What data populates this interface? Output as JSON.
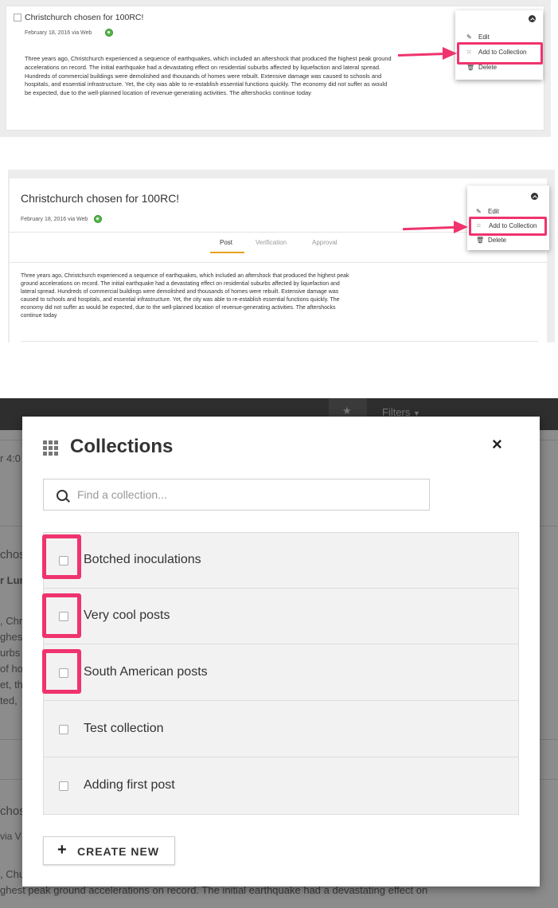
{
  "panel1": {
    "title": "Christchurch chosen for 100RC!",
    "meta": "February 18, 2016 via Web",
    "body": "Three years ago, Christchurch experienced a sequence of earthquakes, which included an aftershock that produced the highest peak ground accelerations on record. The initial earthquake had a devastating effect on residential suburbs affected by liquefaction and lateral spread. Hundreds of commercial buildings were demolished and thousands of homes were rebuilt. Extensive damage was caused to schools and hospitals, and essential infrastructure. Yet, the city was able to re-establish essential functions quickly. The economy did not suffer as would be expected, due to the well-planned location of revenue-generating activities. The aftershocks continue today",
    "menu": {
      "edit": "Edit",
      "add": "Add to Collection",
      "delete": "Delete"
    }
  },
  "panel2": {
    "title": "Christchurch chosen for 100RC!",
    "meta": "February 18, 2016 via Web",
    "tabs": [
      "Post",
      "Verification",
      "Approval"
    ],
    "body": "Three years ago, Christchurch experienced a sequence of earthquakes, which included an aftershock that produced the highest peak ground accelerations on record. The initial earthquake had a devastating effect on residential suburbs affected by liquefaction and lateral spread. Hundreds of commercial buildings were demolished and thousands of homes were rebuilt. Extensive damage was caused to schools and hospitals, and essential infrastructure. Yet, the city was able to re-establish essential functions quickly. The economy did not suffer as would be expected, due to the well-planned location of revenue-generating activities. The aftershocks continue today",
    "menu": {
      "edit": "Edit",
      "add": "Add to Collection",
      "delete": "Delete"
    }
  },
  "panel3": {
    "topbar": {
      "filters": "Filters"
    },
    "background_fragments": [
      "r 4:0",
      "chos",
      "r Lun",
      ", Chr",
      "ghes",
      "urbs a",
      "of ho",
      "et, th",
      "ted,",
      "chos",
      "via V",
      ", Chu"
    ],
    "background_bottom": "ghest peak ground accelerations on record. The initial earthquake had a devastating effect on",
    "modal": {
      "title": "Collections",
      "close": "×",
      "search_placeholder": "Find a collection...",
      "collections": [
        "Botched inoculations",
        "Very cool posts",
        "South American posts",
        "Test collection",
        "Adding first post"
      ],
      "create_label": "CREATE NEW"
    }
  },
  "colors": {
    "highlight": "#f0336e",
    "accent_tab": "#e8a020",
    "green_badge": "#58b84a"
  }
}
